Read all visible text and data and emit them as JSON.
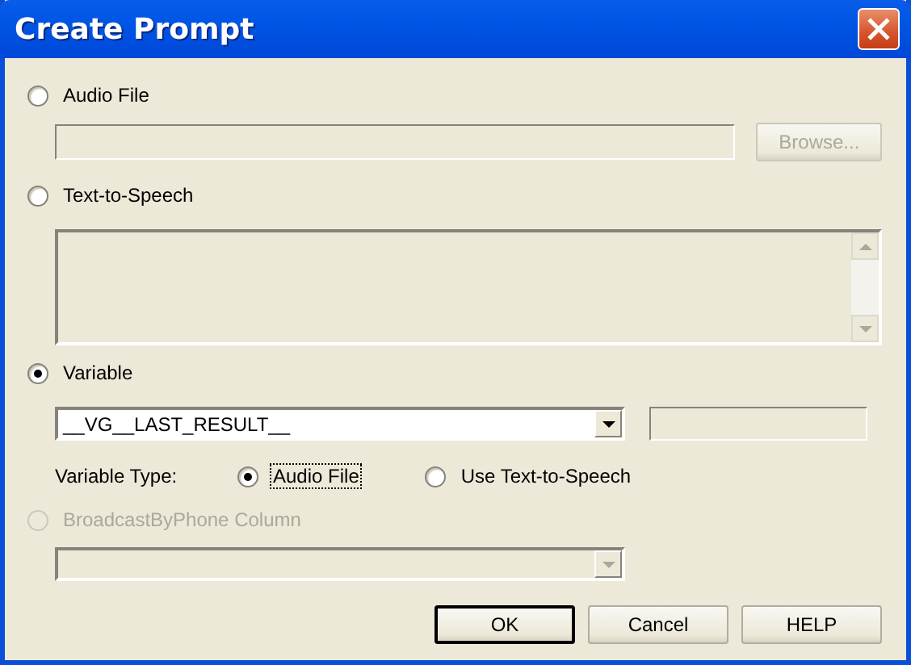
{
  "window": {
    "title": "Create Prompt"
  },
  "audio_file": {
    "label": "Audio File",
    "selected": false,
    "browse_button": {
      "label": "Browse...",
      "disabled": true
    }
  },
  "text_to_speech": {
    "label": "Text-to-Speech",
    "selected": false
  },
  "variable": {
    "label": "Variable",
    "selected": true,
    "dropdown": {
      "value": "__VG__LAST_RESULT__"
    },
    "type_label": "Variable Type:",
    "types": [
      {
        "label": "Audio File",
        "selected": true,
        "focused": true
      },
      {
        "label": "Use Text-to-Speech",
        "selected": false,
        "focused": false
      }
    ]
  },
  "broadcast_column": {
    "label": "BroadcastByPhone Column",
    "selected": false,
    "disabled": true
  },
  "buttons": [
    {
      "label": "OK",
      "default": true
    },
    {
      "label": "Cancel",
      "default": false
    },
    {
      "label": "HELP",
      "default": false
    }
  ]
}
